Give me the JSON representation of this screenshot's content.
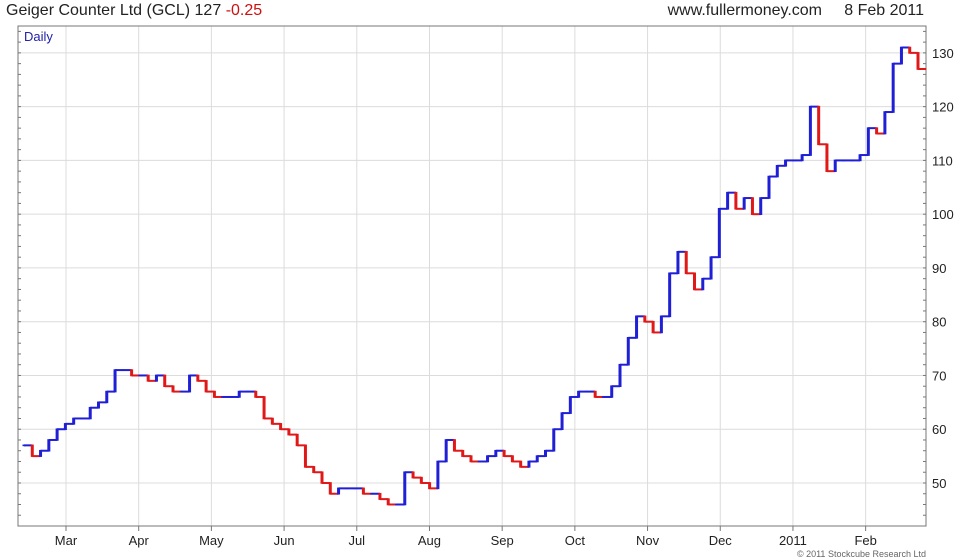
{
  "header": {
    "title": "Geiger Counter Ltd (GCL)",
    "price": "127",
    "change": "-0.25",
    "source": "www.fullermoney.com",
    "date": "8 Feb 2011"
  },
  "chart": {
    "interval_label": "Daily",
    "credit": "© 2011 Stockcube Research Ltd"
  },
  "colors": {
    "up": "#1f1fd6",
    "down": "#e01818",
    "grid": "#dcdcdc",
    "frame": "#777777"
  },
  "chart_data": {
    "type": "line",
    "title": "Geiger Counter Ltd (GCL) 127 -0.25",
    "xlabel": "",
    "ylabel": "",
    "ylim": [
      42,
      135
    ],
    "yticks": [
      50,
      60,
      70,
      80,
      90,
      100,
      110,
      120,
      130
    ],
    "x_tick_labels": [
      "Mar",
      "Apr",
      "May",
      "Jun",
      "Jul",
      "Aug",
      "Sep",
      "Oct",
      "Nov",
      "Dec",
      "2011",
      "Feb"
    ],
    "grid": true,
    "series": [
      {
        "values": [
          57,
          55,
          56,
          58,
          60,
          61,
          62,
          62,
          64,
          65,
          67,
          71,
          71,
          70,
          70,
          69,
          70,
          68,
          67,
          67,
          70,
          69,
          67,
          66,
          66,
          66,
          67,
          67,
          66,
          62,
          61,
          60,
          59,
          57,
          53,
          52,
          50,
          48,
          49,
          49,
          49,
          48,
          48,
          47,
          46,
          46,
          52,
          51,
          50,
          49,
          54,
          58,
          56,
          55,
          54,
          54,
          55,
          56,
          55,
          54,
          53,
          54,
          55,
          56,
          60,
          63,
          66,
          67,
          67,
          66,
          66,
          68,
          72,
          77,
          81,
          80,
          78,
          81,
          89,
          93,
          89,
          86,
          88,
          92,
          101,
          104,
          101,
          103,
          100,
          103,
          107,
          109,
          110,
          110,
          111,
          120,
          113,
          108,
          110,
          110,
          110,
          111,
          116,
          115,
          119,
          128,
          131,
          130,
          127
        ]
      }
    ]
  }
}
